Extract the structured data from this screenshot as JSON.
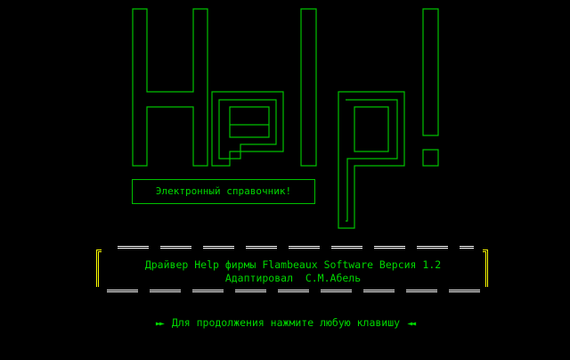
{
  "logo": {
    "text": "Help!",
    "color": "#00c000"
  },
  "subtitle": "Электронный справочник!",
  "info": {
    "line1": "Драйвер Help фирмы Flambeaux Software Версия 1.2",
    "line2": "Адаптировал  С.М.Абель",
    "frame_color": "#ffff00",
    "dash_color": "#ffffff"
  },
  "hint": {
    "text": "Для продолжения нажмите любую клавишу",
    "left_arrow": "►►",
    "right_arrow": "◄◄"
  },
  "colors": {
    "background": "#000000",
    "text_green": "#00d800"
  }
}
